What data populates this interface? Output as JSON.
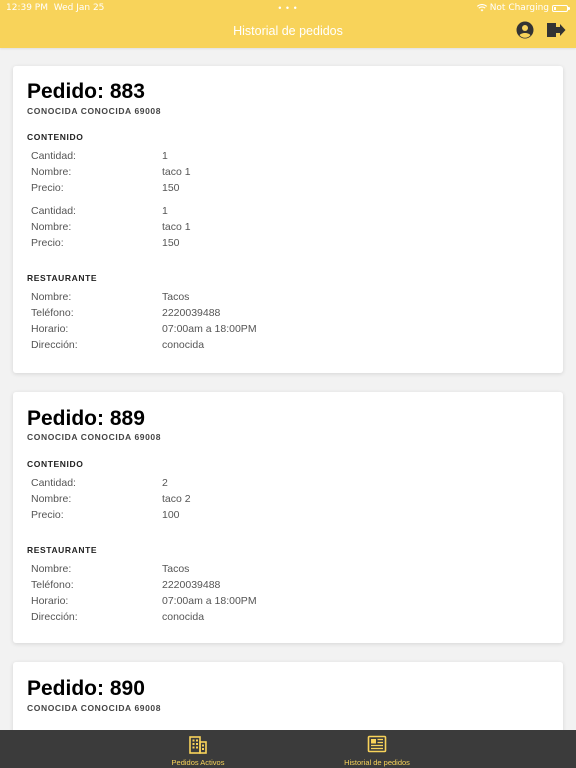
{
  "status_bar": {
    "time": "12:39 PM",
    "date": "Wed Jan 25",
    "dots": "• • •",
    "charging": "Not Charging"
  },
  "header": {
    "title": "Historial de pedidos"
  },
  "orders": [
    {
      "title": "Pedido: 883",
      "address": "CONOCIDA CONOCIDA 69008",
      "content_label": "CONTENIDO",
      "items": [
        {
          "cantidad_label": "Cantidad:",
          "cantidad": "1",
          "nombre_label": "Nombre:",
          "nombre": "taco 1",
          "precio_label": "Precio:",
          "precio": "150"
        },
        {
          "cantidad_label": "Cantidad:",
          "cantidad": "1",
          "nombre_label": "Nombre:",
          "nombre": "taco 1",
          "precio_label": "Precio:",
          "precio": "150"
        }
      ],
      "restaurant_label": "RESTAURANTE",
      "restaurant": {
        "nombre_label": "Nombre:",
        "nombre": "Tacos",
        "telefono_label": "Teléfono:",
        "telefono": "2220039488",
        "horario_label": "Horario:",
        "horario": "07:00am a 18:00PM",
        "direccion_label": "Dirección:",
        "direccion": "conocida"
      }
    },
    {
      "title": "Pedido: 889",
      "address": "CONOCIDA CONOCIDA 69008",
      "content_label": "CONTENIDO",
      "items": [
        {
          "cantidad_label": "Cantidad:",
          "cantidad": "2",
          "nombre_label": "Nombre:",
          "nombre": "taco 2",
          "precio_label": "Precio:",
          "precio": "100"
        }
      ],
      "restaurant_label": "RESTAURANTE",
      "restaurant": {
        "nombre_label": "Nombre:",
        "nombre": "Tacos",
        "telefono_label": "Teléfono:",
        "telefono": "2220039488",
        "horario_label": "Horario:",
        "horario": "07:00am a 18:00PM",
        "direccion_label": "Dirección:",
        "direccion": "conocida"
      }
    },
    {
      "title": "Pedido: 890",
      "address": "CONOCIDA CONOCIDA 69008"
    }
  ],
  "tabs": [
    {
      "label": "Pedidos Activos",
      "icon": "building-icon"
    },
    {
      "label": "Historial de pedidos",
      "icon": "newspaper-icon"
    }
  ],
  "colors": {
    "header": "#f8d35a",
    "tabbar": "#3b3b3b",
    "accent": "#f8d35a",
    "background": "#f2f2f2"
  }
}
